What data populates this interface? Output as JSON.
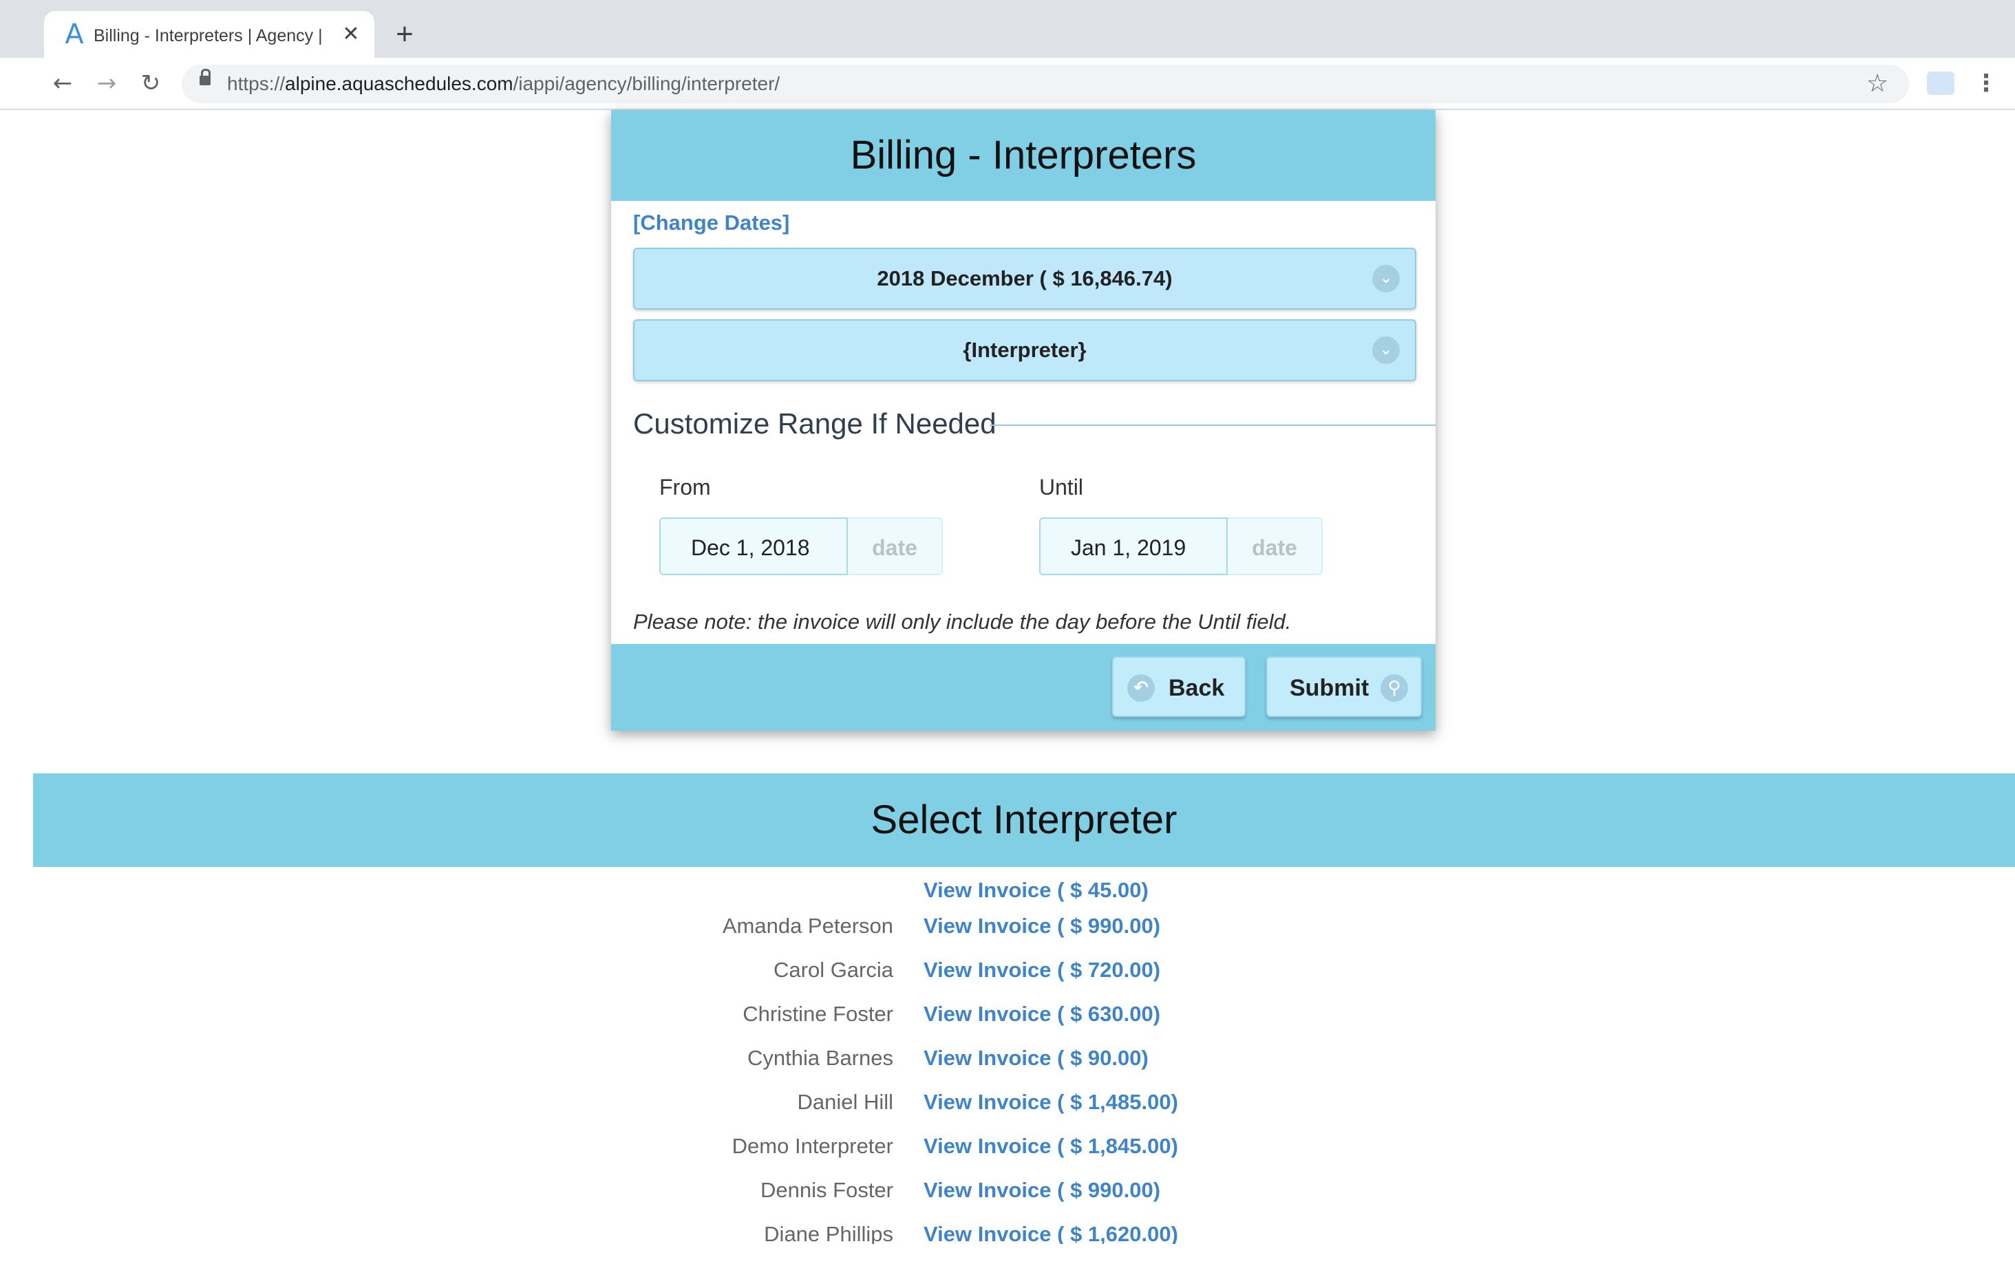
{
  "browser": {
    "tab_favicon": "A",
    "tab_title": "Billing - Interpreters | Agency |",
    "tab_close": "✕",
    "new_tab": "+",
    "url_scheme": "https://",
    "url_host": "alpine.aquaschedules.com",
    "url_path": "/iappi/agency/billing/interpreter/",
    "icons": [
      "back-arrow-icon",
      "forward-arrow-icon",
      "reload-icon",
      "lock-icon",
      "star-icon",
      "extension-icon",
      "menu-dots-icon"
    ]
  },
  "billing": {
    "title": "Billing - Interpreters",
    "change_dates": "[Change Dates]",
    "period_select": "2018 December ( $ 16,846.74)",
    "interpreter_select": "{Interpreter}",
    "customize_legend": "Customize Range If Needed",
    "from_label": "From",
    "from_value": "Dec 1, 2018",
    "from_addon": "date",
    "until_label": "Until",
    "until_value": "Jan 1, 2019",
    "until_addon": "date",
    "note": "Please note: the invoice will only include the day before the Until field.",
    "back_label": "Back",
    "submit_label": "Submit"
  },
  "interpreters": {
    "title": "Select Interpreter",
    "rows": [
      {
        "name": "",
        "link": "View Invoice ( $ 45.00)"
      },
      {
        "name": "Amanda Peterson",
        "link": "View Invoice ( $ 990.00)"
      },
      {
        "name": "Carol Garcia",
        "link": "View Invoice ( $ 720.00)"
      },
      {
        "name": "Christine Foster",
        "link": "View Invoice ( $ 630.00)"
      },
      {
        "name": "Cynthia Barnes",
        "link": "View Invoice ( $ 90.00)"
      },
      {
        "name": "Daniel Hill",
        "link": "View Invoice ( $ 1,485.00)"
      },
      {
        "name": "Demo Interpreter",
        "link": "View Invoice ( $ 1,845.00)"
      },
      {
        "name": "Dennis Foster",
        "link": "View Invoice ( $ 990.00)"
      },
      {
        "name": "Diane Phillips",
        "link": "View Invoice ( $ 1,620.00)"
      }
    ]
  }
}
